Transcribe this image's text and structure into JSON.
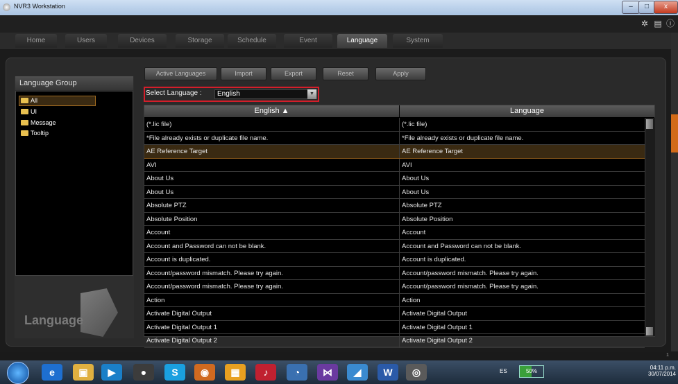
{
  "window": {
    "title": "NVR3 Workstation",
    "min": "–",
    "max": "□",
    "close": "x"
  },
  "top_icons": {
    "settings": "✲",
    "docs": "▤",
    "info": "ⓘ"
  },
  "nav": {
    "tabs": [
      "Home",
      "Users",
      "Devices",
      "Storage",
      "Schedule",
      "Event",
      "Language",
      "System"
    ],
    "active": "Language"
  },
  "language_group": {
    "title": "Language Group",
    "items": [
      "All",
      "UI",
      "Message",
      "Tooltip"
    ],
    "selected": "All",
    "logo_text": "Language"
  },
  "toolbar": {
    "active_languages": "Active Languages",
    "import": "Import",
    "export": "Export",
    "reset": "Reset",
    "apply": "Apply"
  },
  "select_language": {
    "label": "Select Language :",
    "value": "English",
    "arrow": "▼"
  },
  "table": {
    "columns": [
      "English ▲",
      "Language"
    ],
    "selected_row": 2,
    "rows": [
      [
        "(*.lic file)",
        "(*.lic file)"
      ],
      [
        "*File already exists or duplicate file name.",
        "*File already exists or duplicate file name."
      ],
      [
        "AE Reference Target",
        "AE Reference Target"
      ],
      [
        "AVI",
        "AVI"
      ],
      [
        "About Us",
        "About Us"
      ],
      [
        "About Us",
        "About Us"
      ],
      [
        "Absolute PTZ",
        "Absolute PTZ"
      ],
      [
        "Absolute Position",
        "Absolute Position"
      ],
      [
        "Account",
        "Account"
      ],
      [
        "Account and Password can not be blank.",
        "Account and Password can not be blank."
      ],
      [
        "Account is duplicated.",
        "Account is duplicated."
      ],
      [
        "Account/password mismatch. Please try again.",
        "Account/password mismatch. Please try again."
      ],
      [
        "Account/password mismatch. Please try again.",
        "Account/password mismatch. Please try again."
      ],
      [
        "Action",
        "Action"
      ],
      [
        "Activate Digital Output",
        "Activate Digital Output"
      ],
      [
        "Activate Digital Output 1",
        "Activate Digital Output 1"
      ],
      [
        "Activate Digital Output 2",
        "Activate Digital Output 2"
      ]
    ]
  },
  "status": {
    "zoom_indicator": "1"
  },
  "taskbar": {
    "icons": [
      "ie-icon",
      "folder-icon",
      "media-icon",
      "chrome-icon",
      "skype-icon",
      "firefox-icon",
      "photos-icon",
      "itunes-icon",
      "chat-icon",
      "vs-icon",
      "app-icon",
      "word-icon",
      "nvr-icon"
    ],
    "tray_lang": "ES",
    "battery": "50%",
    "time": "04:11 p.m.",
    "date": "30/07/2014"
  }
}
